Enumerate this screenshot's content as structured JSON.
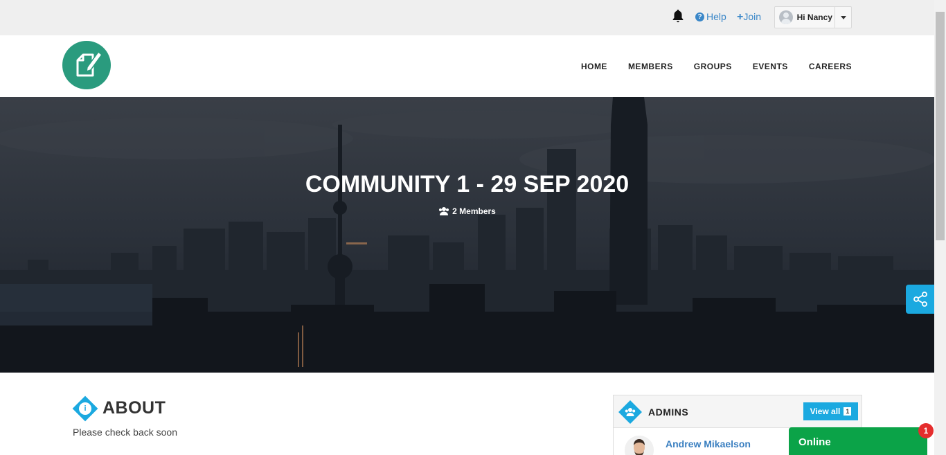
{
  "topbar": {
    "help_label": "Help",
    "join_label": "Join",
    "user_greeting": "Hi Nancy"
  },
  "nav": {
    "items": [
      "HOME",
      "MEMBERS",
      "GROUPS",
      "EVENTS",
      "CAREERS"
    ]
  },
  "hero": {
    "title": "COMMUNITY 1 - 29 SEP 2020",
    "members_label": "2 Members"
  },
  "about": {
    "title": "ABOUT",
    "text": "Please check back soon"
  },
  "admins": {
    "title": "ADMINS",
    "view_all_label": "View all",
    "count": "1",
    "list": [
      {
        "name": "Andrew Mikaelson"
      }
    ]
  },
  "chat": {
    "status_label": "Online",
    "unread_count": "1"
  },
  "colors": {
    "accent": "#1ba9e0",
    "logo": "#2a9b7e",
    "link": "#3a87c8",
    "online": "#0ba348",
    "badge": "#e52d2d"
  },
  "icons": [
    "bell-icon",
    "help-icon",
    "plus-icon",
    "user-avatar",
    "chevron-down-icon",
    "logo-edit-icon",
    "users-icon",
    "share-icon",
    "info-icon",
    "admins-icon"
  ]
}
